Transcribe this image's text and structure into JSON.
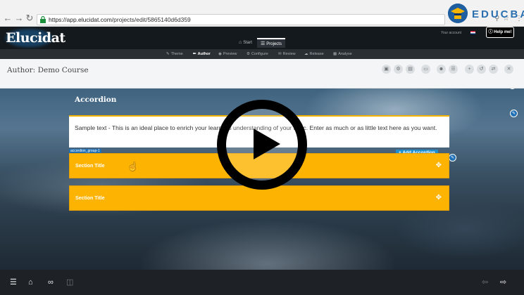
{
  "browser": {
    "url_host": "https://app.elucidat.com",
    "url_path": "/projects/edit/5865140d6d359",
    "back_icon": "arrow-left-icon",
    "forward_icon": "arrow-right-icon",
    "reload_icon": "reload-icon"
  },
  "brand_watermark": {
    "text": "EDUCBA",
    "color": "#2a6fb0"
  },
  "app": {
    "logo": "Elucidat",
    "tabs": [
      {
        "label": "Start",
        "icon": "home-icon",
        "active": false
      },
      {
        "label": "Projects",
        "icon": "list-icon",
        "active": true
      }
    ],
    "lang_label": "Your account",
    "help_label": "Help me!"
  },
  "sub_nav": [
    {
      "label": "Theme",
      "icon": "brush-icon"
    },
    {
      "label": "Author",
      "icon": "pencil-icon",
      "active": true
    },
    {
      "label": "Preview",
      "icon": "eye-icon"
    },
    {
      "label": "Configure",
      "icon": "gears-icon"
    },
    {
      "label": "Review",
      "icon": "comments-icon"
    },
    {
      "label": "Release",
      "icon": "cloud-icon"
    },
    {
      "label": "Analyse",
      "icon": "bar-chart-icon"
    }
  ],
  "author_bar": {
    "title_prefix": "Author:",
    "course_name": "Demo Course",
    "tools": [
      "save-icon",
      "settings-icon",
      "image-icon",
      "monitor-icon",
      "person-icon",
      "list-icon",
      "add-icon",
      "history-icon",
      "shuffle-icon",
      "trash-icon"
    ]
  },
  "page": {
    "heading": "Accordion",
    "body_text": "Sample text - This is an ideal place to enrich your learner's understanding of your topic. Enter as much or as little text here as you want.",
    "group_label": "accordion_group-1",
    "add_button": "+ Add Accordion",
    "sections": [
      {
        "title": "Section Title"
      },
      {
        "title": "Section Title"
      }
    ],
    "accent_color": "#fdb301"
  },
  "bottom_bar": {
    "left_icons": [
      "layers-icon",
      "home-icon",
      "link-icon",
      "folder-icon"
    ],
    "right_icons": [
      "prev-arrow-icon",
      "next-arrow-icon"
    ]
  }
}
